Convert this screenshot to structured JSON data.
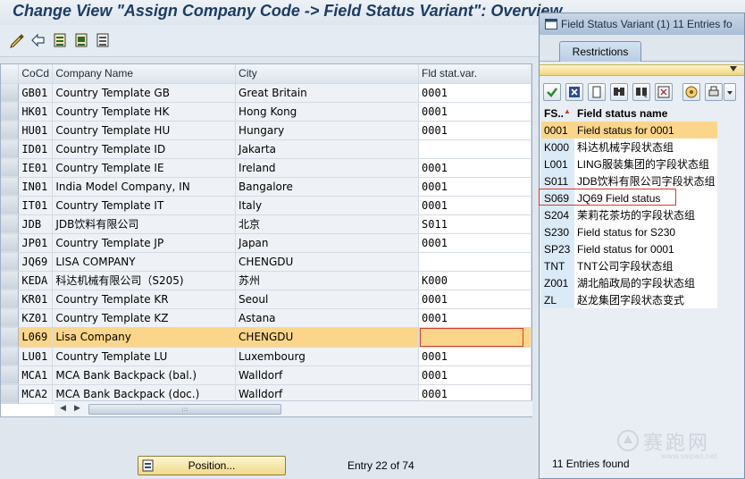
{
  "window_title": "Change View \"Assign Company Code -> Field Status Variant\": Overview",
  "toolbar": {
    "icons": [
      "edit-pencil-icon",
      "undo-icon",
      "select-all-icon",
      "select-block-icon",
      "deselect-icon"
    ]
  },
  "table": {
    "headers": {
      "code": "CoCd",
      "name": "Company Name",
      "city": "City",
      "variant": "Fld stat.var."
    },
    "rows": [
      {
        "code": "GB01",
        "name": "Country Template GB",
        "city": "Great Britain",
        "variant": "0001"
      },
      {
        "code": "HK01",
        "name": "Country Template HK",
        "city": "Hong Kong",
        "variant": "0001"
      },
      {
        "code": "HU01",
        "name": "Country Template HU",
        "city": "Hungary",
        "variant": "0001"
      },
      {
        "code": "ID01",
        "name": "Country Template ID",
        "city": "Jakarta",
        "variant": ""
      },
      {
        "code": "IE01",
        "name": "Country Template IE",
        "city": "Ireland",
        "variant": "0001"
      },
      {
        "code": "IN01",
        "name": "India Model Company, IN",
        "city": "Bangalore",
        "variant": "0001"
      },
      {
        "code": "IT01",
        "name": "Country Template IT",
        "city": "Italy",
        "variant": "0001"
      },
      {
        "code": "JDB",
        "name": "JDB饮料有限公司",
        "city": "北京",
        "variant": "S011"
      },
      {
        "code": "JP01",
        "name": "Country Template JP",
        "city": "Japan",
        "variant": "0001"
      },
      {
        "code": "JQ69",
        "name": "LISA COMPANY",
        "city": "CHENGDU",
        "variant": ""
      },
      {
        "code": "KEDA",
        "name": "科达机械有限公司（S205)",
        "city": "苏州",
        "variant": "K000"
      },
      {
        "code": "KR01",
        "name": "Country Template KR",
        "city": "Seoul",
        "variant": "0001"
      },
      {
        "code": "KZ01",
        "name": "Country Template KZ",
        "city": "Astana",
        "variant": "0001"
      },
      {
        "code": "L069",
        "name": "Lisa Company",
        "city": "CHENGDU",
        "variant": ""
      },
      {
        "code": "LU01",
        "name": "Country Template LU",
        "city": "Luxembourg",
        "variant": "0001"
      },
      {
        "code": "MCA1",
        "name": "MCA Bank Backpack (bal.)",
        "city": "Walldorf",
        "variant": "0001"
      },
      {
        "code": "MCA2",
        "name": "MCA Bank Backpack (doc.)",
        "city": "Walldorf",
        "variant": "0001"
      }
    ],
    "highlighted_row": "L069",
    "scroll_thumb": ":::"
  },
  "footer": {
    "position_button": "Position...",
    "entry_info": "Entry 22 of 74"
  },
  "popup": {
    "title": "Field Status Variant (1)   11 Entries fo",
    "tab": "Restrictions",
    "toolbar_icons": [
      "checkmark-icon",
      "cancel-icon",
      "new-icon",
      "find-icon",
      "find-next-icon",
      "sort-icon",
      "info-icon",
      "print-icon",
      "dropdown-icon"
    ],
    "headers": {
      "key": "FS..",
      "name": "Field status name"
    },
    "rows": [
      {
        "key": "0001",
        "name": "Field status for 0001"
      },
      {
        "key": "K000",
        "name": "科达机械字段状态组"
      },
      {
        "key": "L001",
        "name": "LING服装集团的字段状态组"
      },
      {
        "key": "S011",
        "name": "JDB饮料有限公司字段状态组"
      },
      {
        "key": "S069",
        "name": "JQ69 Field status"
      },
      {
        "key": "S204",
        "name": "茉莉花茶坊的字段状态组"
      },
      {
        "key": "S230",
        "name": "Field status for S230"
      },
      {
        "key": "SP23",
        "name": "Field status for 0001"
      },
      {
        "key": "TNT",
        "name": "TNT公司字段状态组"
      },
      {
        "key": "Z001",
        "name": "湖北船政局的字段状态组"
      },
      {
        "key": "ZL",
        "name": "赵龙集团字段状态变式"
      }
    ],
    "highlighted_key": "0001",
    "boxed_key": "S069",
    "footer": "11 Entries found"
  },
  "watermark": {
    "text": "赛跑网",
    "url": "www.saipao.net"
  },
  "colors": {
    "highlight": "#fbd68a",
    "title_text": "#1b3c66",
    "red_frame": "#d73a2a"
  }
}
